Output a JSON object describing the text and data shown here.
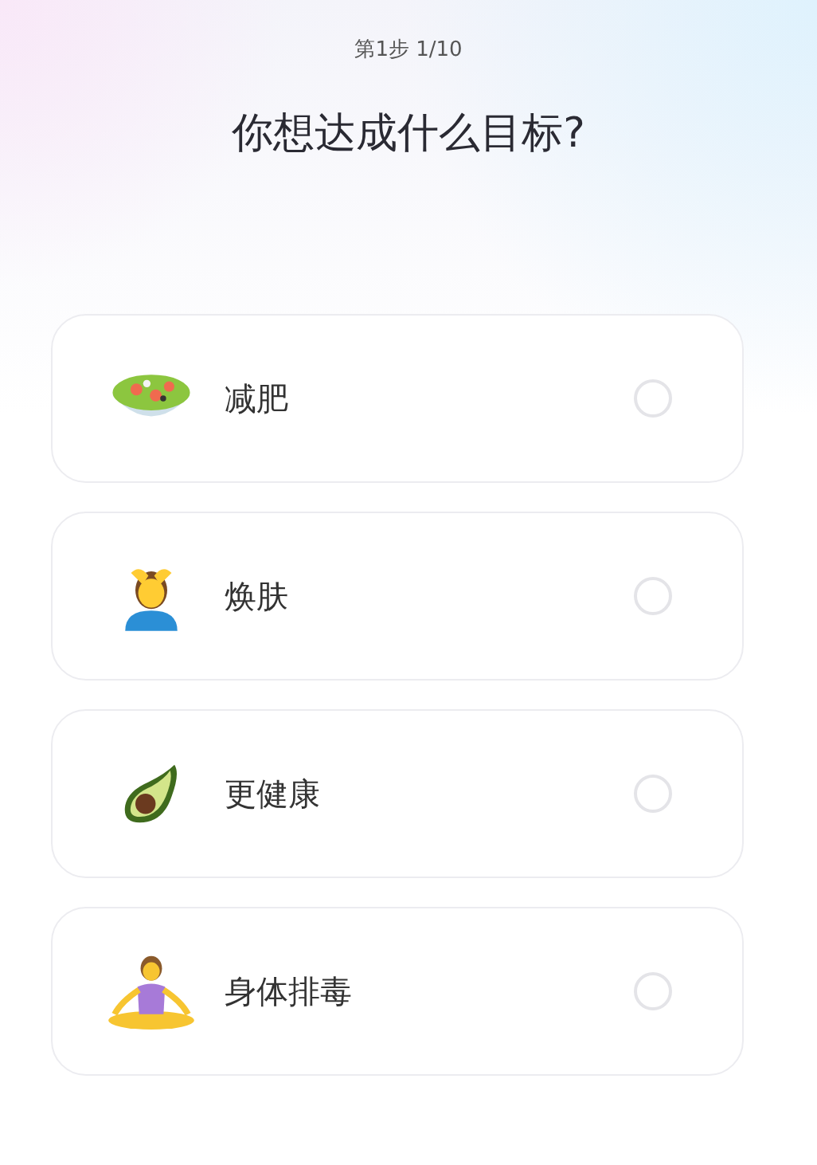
{
  "step": "第1步 1/10",
  "title": "你想达成什么目标?",
  "options": [
    {
      "label": "减肥",
      "selected": false
    },
    {
      "label": "焕肤",
      "selected": false
    },
    {
      "label": "更健康",
      "selected": false
    },
    {
      "label": "身体排毒",
      "selected": false
    }
  ]
}
